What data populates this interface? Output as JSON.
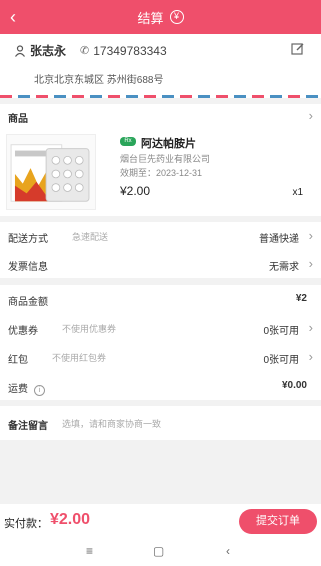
{
  "header": {
    "title": "结算",
    "back_icon": "back-arrow-icon",
    "currency_icon": "yen-circle-icon",
    "currency_symbol": "¥",
    "back_glyph": "‹",
    "bg": "#ef4f6b"
  },
  "address": {
    "name": "张志永",
    "phone": "17349783343",
    "phone_glyph": "✆",
    "address": "北京北京东城区 苏州街688号"
  },
  "goods": {
    "section_label": "商品",
    "chevron": "›",
    "product": {
      "badge": "Rx",
      "name": "阿达帕胺片",
      "company": "烟台巨先药业有限公司",
      "expiry": "效期至：2023-12-31",
      "price": "¥2.00",
      "qty": "x1"
    }
  },
  "options": {
    "delivery_label": "配送方式",
    "delivery_hint": "急速配送",
    "delivery_value": "普通快递",
    "invoice_label": "发票信息",
    "invoice_value": "无需求"
  },
  "money": {
    "goods_amount_label": "商品金额",
    "goods_amount_value": "¥2",
    "coupon_label": "优惠券",
    "coupon_hint": "不使用优惠券",
    "coupon_value": "0张可用",
    "redpack_label": "红包",
    "redpack_hint": "不使用红包券",
    "redpack_value": "0张可用",
    "shipping_label": "运费",
    "shipping_info_glyph": "i",
    "shipping_value": "¥0.00"
  },
  "remark": {
    "label": "备注留言",
    "placeholder": "选填，请和商家协商一致"
  },
  "footer": {
    "pay_label": "实付款：",
    "pay_amount": "¥2.00",
    "submit_label": "提交订单"
  },
  "navbar": {
    "menu": "≡",
    "home": "▢",
    "back": "‹"
  }
}
